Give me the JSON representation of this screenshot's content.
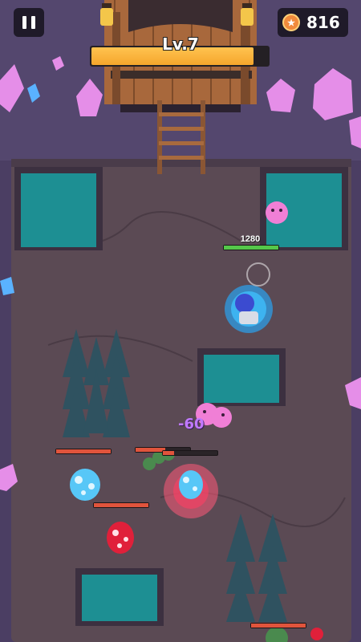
{
  "hud": {
    "level_label": "Lv.7",
    "level_progress": 0.92,
    "coin_count": "816",
    "coin_icon": "coin-icon",
    "pause_icon": "pause-icon"
  },
  "player": {
    "hp_value": "1280",
    "hp_fraction": 1.0
  },
  "floating_damage": "-60",
  "enemy_bars": [
    {
      "id": "enemy-bar-left-top",
      "fraction": 1.0
    },
    {
      "id": "enemy-bar-center-a",
      "fraction": 0.55
    },
    {
      "id": "enemy-bar-center-b",
      "fraction": 0.2
    },
    {
      "id": "enemy-bar-left-mid",
      "fraction": 1.0
    },
    {
      "id": "enemy-bar-bottom-right",
      "fraction": 1.0
    }
  ],
  "colors": {
    "floor": "#5a4a52",
    "wall": "#4b3e63",
    "water": "#1d8f93",
    "player_hp": "#55c74a",
    "enemy_hp": "#e0543c",
    "gold": "#f5a62c"
  }
}
